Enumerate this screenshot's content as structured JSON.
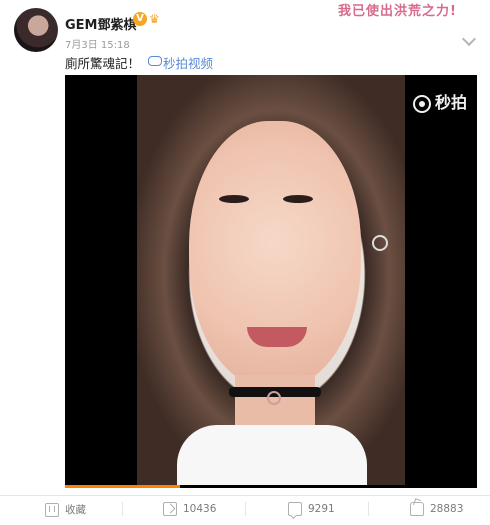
{
  "header": {
    "username": "GEM鄧紫棋",
    "verified_badge": "V",
    "vip_icon": "crown",
    "stamp_text": "我已使出洪荒之力!",
    "time": "7月3日 15:18",
    "source_link": "秒拍视频"
  },
  "post": {
    "text": "廁所驚魂記！",
    "video": {
      "logo_text": "秒拍",
      "progress": 0.28,
      "colors": {
        "progress": "#ff8200",
        "background": "#000000"
      }
    }
  },
  "footer": {
    "collect": "收藏",
    "share_count": "10436",
    "comment_count": "9291",
    "like_count": "28883"
  }
}
